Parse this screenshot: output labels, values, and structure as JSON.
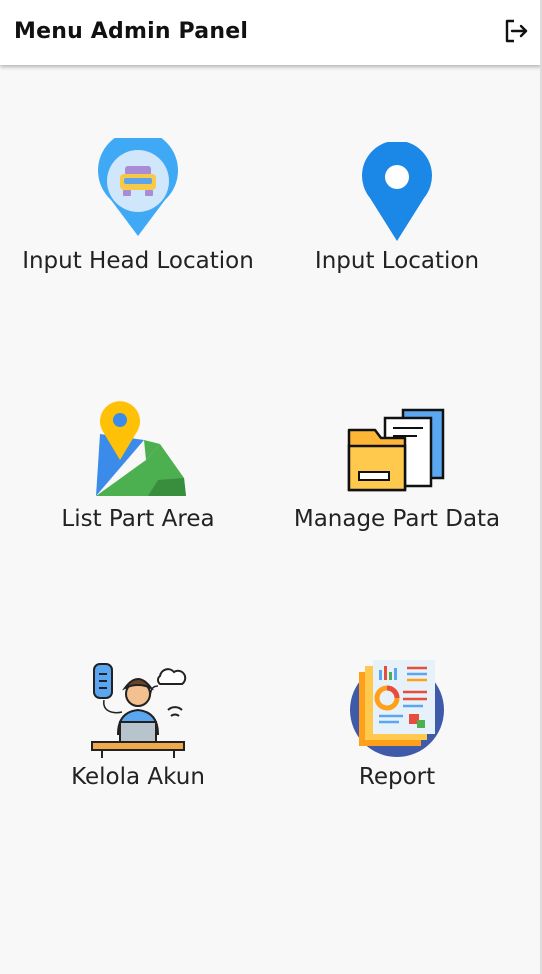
{
  "appbar": {
    "title": "Menu Admin Panel",
    "logout_icon": "logout-icon"
  },
  "menu": [
    {
      "id": "input-head-location",
      "label": "Input Head Location",
      "icon": "head-location-pin-icon"
    },
    {
      "id": "input-location",
      "label": "Input Location",
      "icon": "location-pin-icon"
    },
    {
      "id": "list-part-area",
      "label": "List Part Area",
      "icon": "map-area-icon"
    },
    {
      "id": "manage-part-data",
      "label": "Manage Part Data",
      "icon": "folder-documents-icon"
    },
    {
      "id": "kelola-akun",
      "label": "Kelola Akun",
      "icon": "user-workstation-icon"
    },
    {
      "id": "report",
      "label": "Report",
      "icon": "report-chart-icon"
    }
  ],
  "colors": {
    "background": "#f8f8f8",
    "appbar": "#ffffff",
    "text": "#222222",
    "pin_blue": "#1b87e6",
    "pin_light_blue": "#3fa9f5",
    "map_green": "#4caf50",
    "pin_yellow": "#ffc107",
    "folder_yellow": "#ffb636",
    "report_circle": "#3f5aa8"
  }
}
